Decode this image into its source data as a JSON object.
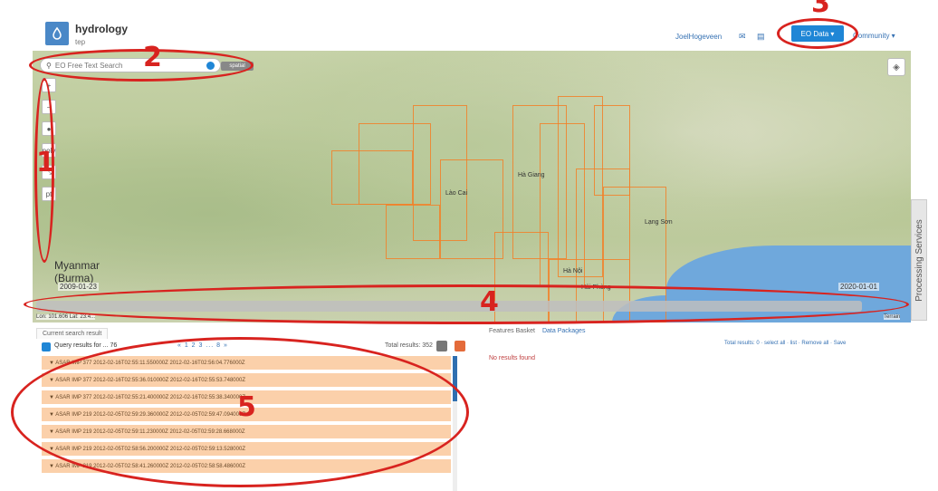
{
  "header": {
    "app_title": "hydrology",
    "app_subtitle": "tep",
    "user": "JoelHogeveen",
    "eo_data_label": "EO Data ▾",
    "community_label": "Community ▾",
    "icons": [
      "logo-icon",
      "mail-icon",
      "notes-icon"
    ]
  },
  "map": {
    "search_placeholder": "EO Free Text Search",
    "spatial_toggle": "spatial",
    "country_label_1": "Myanmar",
    "country_label_2": "(Burma)",
    "place_labels": [
      "Hà Giang",
      "Lào Cai",
      "Hà Nội",
      "Hải Phòng",
      "Lạng Sơn"
    ],
    "time_start": "2009-01-23",
    "time_end": "2020-01-01",
    "coords_text": "Lon: 101.606 Lat: 23.4...",
    "attribution": "Terrain",
    "toolbar": [
      "+",
      "−",
      "●",
      "poly",
      "⤡",
      "pt"
    ],
    "processing_tab": "Processing Services"
  },
  "results": {
    "tab_current": "Current search result",
    "heading": "Query results for ... 76",
    "pager": "« 1 2 3 ... 8 »",
    "total": "Total results: 352",
    "items": [
      "▼ ASAR IMP 377 2012-02-16T02:55:11.550000Z 2012-02-16T02:56:04.776000Z",
      "▼ ASAR IMP 377 2012-02-16T02:55:36.010000Z 2012-02-16T02:55:53.748000Z",
      "▼ ASAR IMP 377 2012-02-16T02:55:21.400000Z 2012-02-16T02:55:38.340000Z",
      "▼ ASAR IMP 219 2012-02-05T02:59:29.360000Z 2012-02-05T02:59:47.094000Z",
      "▼ ASAR IMP 219 2012-02-05T02:59:11.230000Z 2012-02-05T02:59:28.668000Z",
      "▼ ASAR IMP 219 2012-02-05T02:58:56.200000Z 2012-02-05T02:59:13.528000Z",
      "▼ ASAR IMP 219 2012-02-05T02:58:41.260000Z 2012-02-05T02:58:58.486000Z"
    ]
  },
  "basket": {
    "tab_features": "Features Basket",
    "tab_packages": "Data Packages",
    "total": "Total results: 0 · select all · list · Remove all · Save",
    "no_results": "No results found"
  },
  "annotations": [
    "1",
    "2",
    "3",
    "4",
    "5"
  ],
  "colors": {
    "accent": "#1f86d6",
    "annotation_red": "#d8231f",
    "footprint_orange": "#f28028",
    "result_row": "#fbd0aa"
  }
}
